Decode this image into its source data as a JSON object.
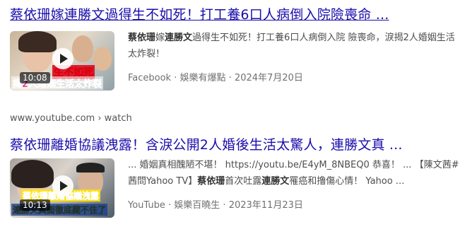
{
  "results": [
    {
      "title": "蔡依珊嫁連勝文過得生不如死！打工養6口人病倒入院險喪命 ...",
      "thumbnail": {
        "duration": "10:08",
        "caption_top": "生不如死",
        "caption_bottom": "揭2人婚姻生活太炸裂",
        "play_icon": "play-icon"
      },
      "snippet": {
        "part1": "蔡依珊",
        "part2": "嫁",
        "part3": "連勝文",
        "part4": "過得生不如死！打工養6口人病倒入院 險喪命，淚揭2人婚姻生活太炸裂！"
      },
      "meta": {
        "source": "Facebook",
        "sep1": " · ",
        "author": "娛樂有爆點",
        "sep2": " · ",
        "date": "2024年7月20日"
      }
    },
    {
      "url": "www.youtube.com › watch",
      "title": "蔡依珊離婚協議洩露！含淚公開2人婚後生活太驚人，連勝文真 ...",
      "thumbnail": {
        "duration": "10:13",
        "caption_top": "蔡依珊離婚協議洩露",
        "caption_bottom": "連勝文真面徹底藏不住了",
        "play_icon": "play-icon"
      },
      "snippet": {
        "part1": "... 婚姻真相醜陋不堪！ https://youtu.be/E4yM_8NBEQ0 恭喜！ ... 【陳文茜#茜問Yahoo TV】",
        "part2": "蔡依珊",
        "part3": "首次吐露",
        "part4": "連勝文",
        "part5": "罹癌和撸傷心情！ Yahoo ..."
      },
      "meta": {
        "source": "YouTube",
        "sep1": " · ",
        "author": "娛樂百曉生",
        "sep2": " · ",
        "date": "2023年11月23日"
      }
    }
  ]
}
